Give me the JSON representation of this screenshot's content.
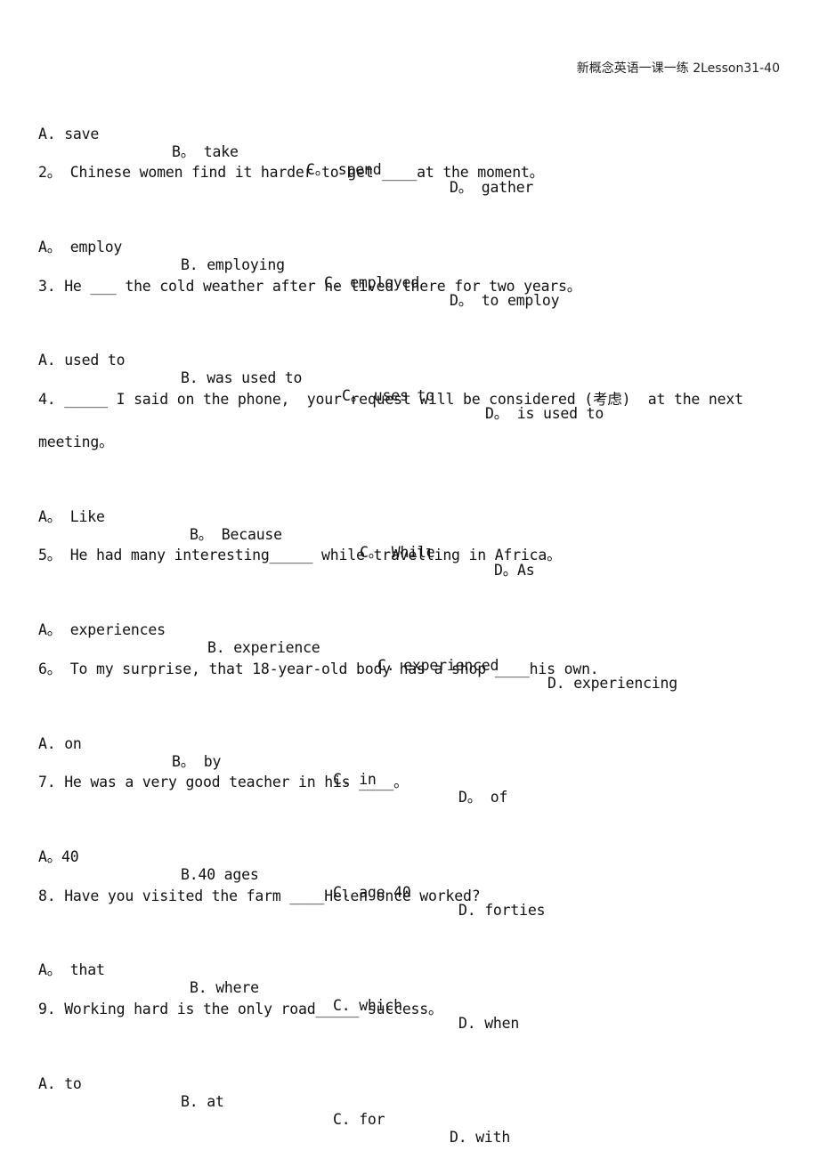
{
  "header": {
    "title": "新概念英语一课一练 2Lesson31-40"
  },
  "items": [
    {
      "type": "options",
      "options": [
        "A. save",
        "B。 take",
        "C。 spend",
        "D。 gather"
      ]
    },
    {
      "type": "question",
      "text": "2。 Chinese women find it harder to get ____at the moment。"
    },
    {
      "type": "options",
      "options": [
        "A。 employ",
        "B. employing",
        "C. employed",
        "D。 to employ"
      ]
    },
    {
      "type": "question",
      "text": "3. He ___ the cold weather after he lived there for two years。"
    },
    {
      "type": "options",
      "options": [
        "A. used to",
        "B. was used to",
        "C。 uses to",
        "D。 is used to"
      ]
    },
    {
      "type": "question",
      "text": "4. _____ I said on the phone,  your request will be considered (考虑)  at the next",
      "continuation": "meeting。"
    },
    {
      "type": "options",
      "options": [
        "A。 Like",
        "B。 Because",
        "C。 While",
        "D。As"
      ]
    },
    {
      "type": "question",
      "text": "5。 He had many interesting_____ while travelling in Africa。"
    },
    {
      "type": "options",
      "options": [
        "A。 experiences",
        "B. experience",
        "C. experienced",
        "D. experiencing"
      ]
    },
    {
      "type": "question",
      "text": "6。 To my surprise, that 18-year-old body has a shop ____his own."
    },
    {
      "type": "options",
      "options": [
        "A. on",
        "B。 by",
        "C. in",
        "D。 of"
      ]
    },
    {
      "type": "question",
      "text": "7. He was a very good teacher in his ____。"
    },
    {
      "type": "options",
      "options": [
        "A。40",
        "B.40 ages",
        "C. age 40",
        "D. forties"
      ]
    },
    {
      "type": "question",
      "text": "8. Have you visited the farm ____Helen once worked?"
    },
    {
      "type": "options",
      "options": [
        "A。 that",
        "B. where",
        "C. which",
        "D. when"
      ]
    },
    {
      "type": "question",
      "text": "9. Working hard is the only road_____ success。"
    },
    {
      "type": "options",
      "options": [
        "A. to",
        "B. at",
        "C. for",
        "D. with"
      ]
    }
  ]
}
